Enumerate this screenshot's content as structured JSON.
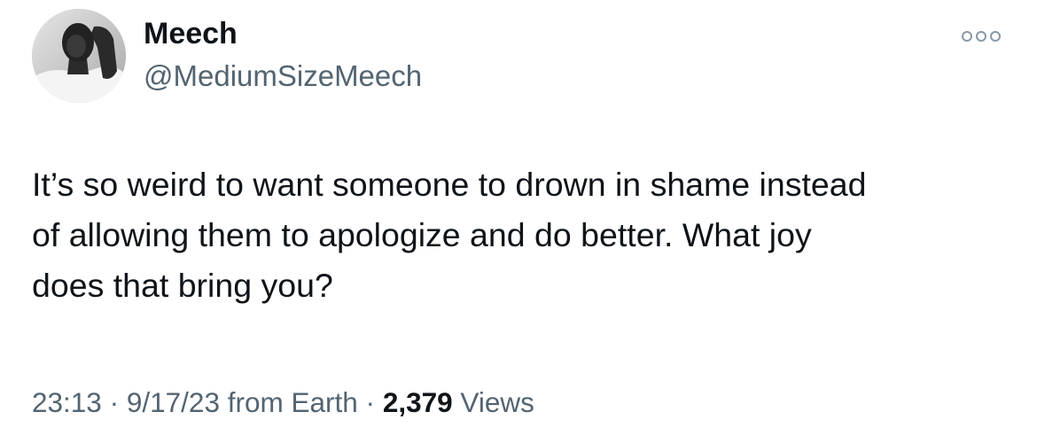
{
  "author": {
    "display_name": "Meech",
    "handle": "@MediumSizeMeech"
  },
  "tweet": {
    "lines": [
      "It’s so weird to want someone to drown in shame instead",
      "of allowing them to apologize and do better. What joy",
      "does that bring you?"
    ]
  },
  "meta": {
    "time": "23:13",
    "separator": "·",
    "date": "9/17/23",
    "source": "from Earth",
    "views_count": "2,379",
    "views_label": "Views"
  },
  "icons": {
    "more": "more-horizontal-icon"
  },
  "colors": {
    "text_primary": "#0f1419",
    "text_secondary": "#536471",
    "more_icon": "#8899a6"
  }
}
